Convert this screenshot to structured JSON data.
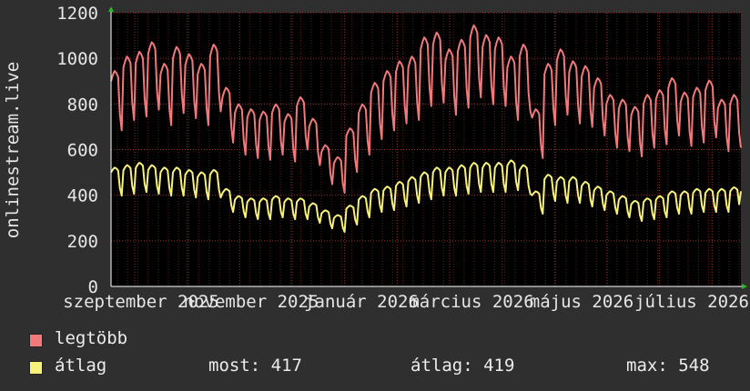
{
  "chart_data": {
    "type": "line",
    "ylabel": "onlinestream.live",
    "ylim": [
      0,
      1200
    ],
    "yticks": [
      "0",
      "200",
      "400",
      "600",
      "800",
      "1000",
      "1200"
    ],
    "xticks": [
      "szeptember 2025",
      "november 2025",
      "január 2026",
      "március 2026",
      "május 2026",
      "július 2026"
    ],
    "x_range": [
      "2025-08",
      "2026-07"
    ],
    "grid": true,
    "background": "#000000",
    "series": [
      {
        "name": "legtöbb",
        "color": "#f0797b",
        "weekly_values": [
          900,
          960,
          980,
          1020,
          930,
          1000,
          970,
          930,
          1010,
          830,
          760,
          740,
          730,
          760,
          720,
          790,
          700,
          590,
          540,
          660,
          760,
          850,
          900,
          940,
          960,
          1040,
          1060,
          990,
          1030,
          1090,
          1050,
          1040,
          960,
          1010,
          740,
          930,
          990,
          940,
          920,
          870,
          800,
          780,
          750,
          800,
          820,
          870,
          810,
          830,
          860,
          780,
          800
        ]
      },
      {
        "name": "átlag",
        "color": "#f7f27a",
        "weekly_values": [
          500,
          510,
          520,
          510,
          500,
          500,
          490,
          480,
          490,
          410,
          380,
          370,
          370,
          380,
          370,
          370,
          350,
          320,
          300,
          340,
          380,
          410,
          420,
          440,
          460,
          480,
          500,
          500,
          510,
          520,
          520,
          520,
          530,
          510,
          400,
          470,
          460,
          460,
          440,
          420,
          400,
          380,
          360,
          370,
          380,
          400,
          400,
          410,
          410,
          410,
          417
        ]
      }
    ]
  },
  "legend": {
    "items": [
      {
        "label": "legtöbb",
        "color": "#f0797b"
      },
      {
        "label": "átlag",
        "color": "#f7f27a"
      }
    ],
    "stats": {
      "most": "most: 417",
      "atlag": "átlag: 419",
      "max": "max: 548"
    }
  }
}
